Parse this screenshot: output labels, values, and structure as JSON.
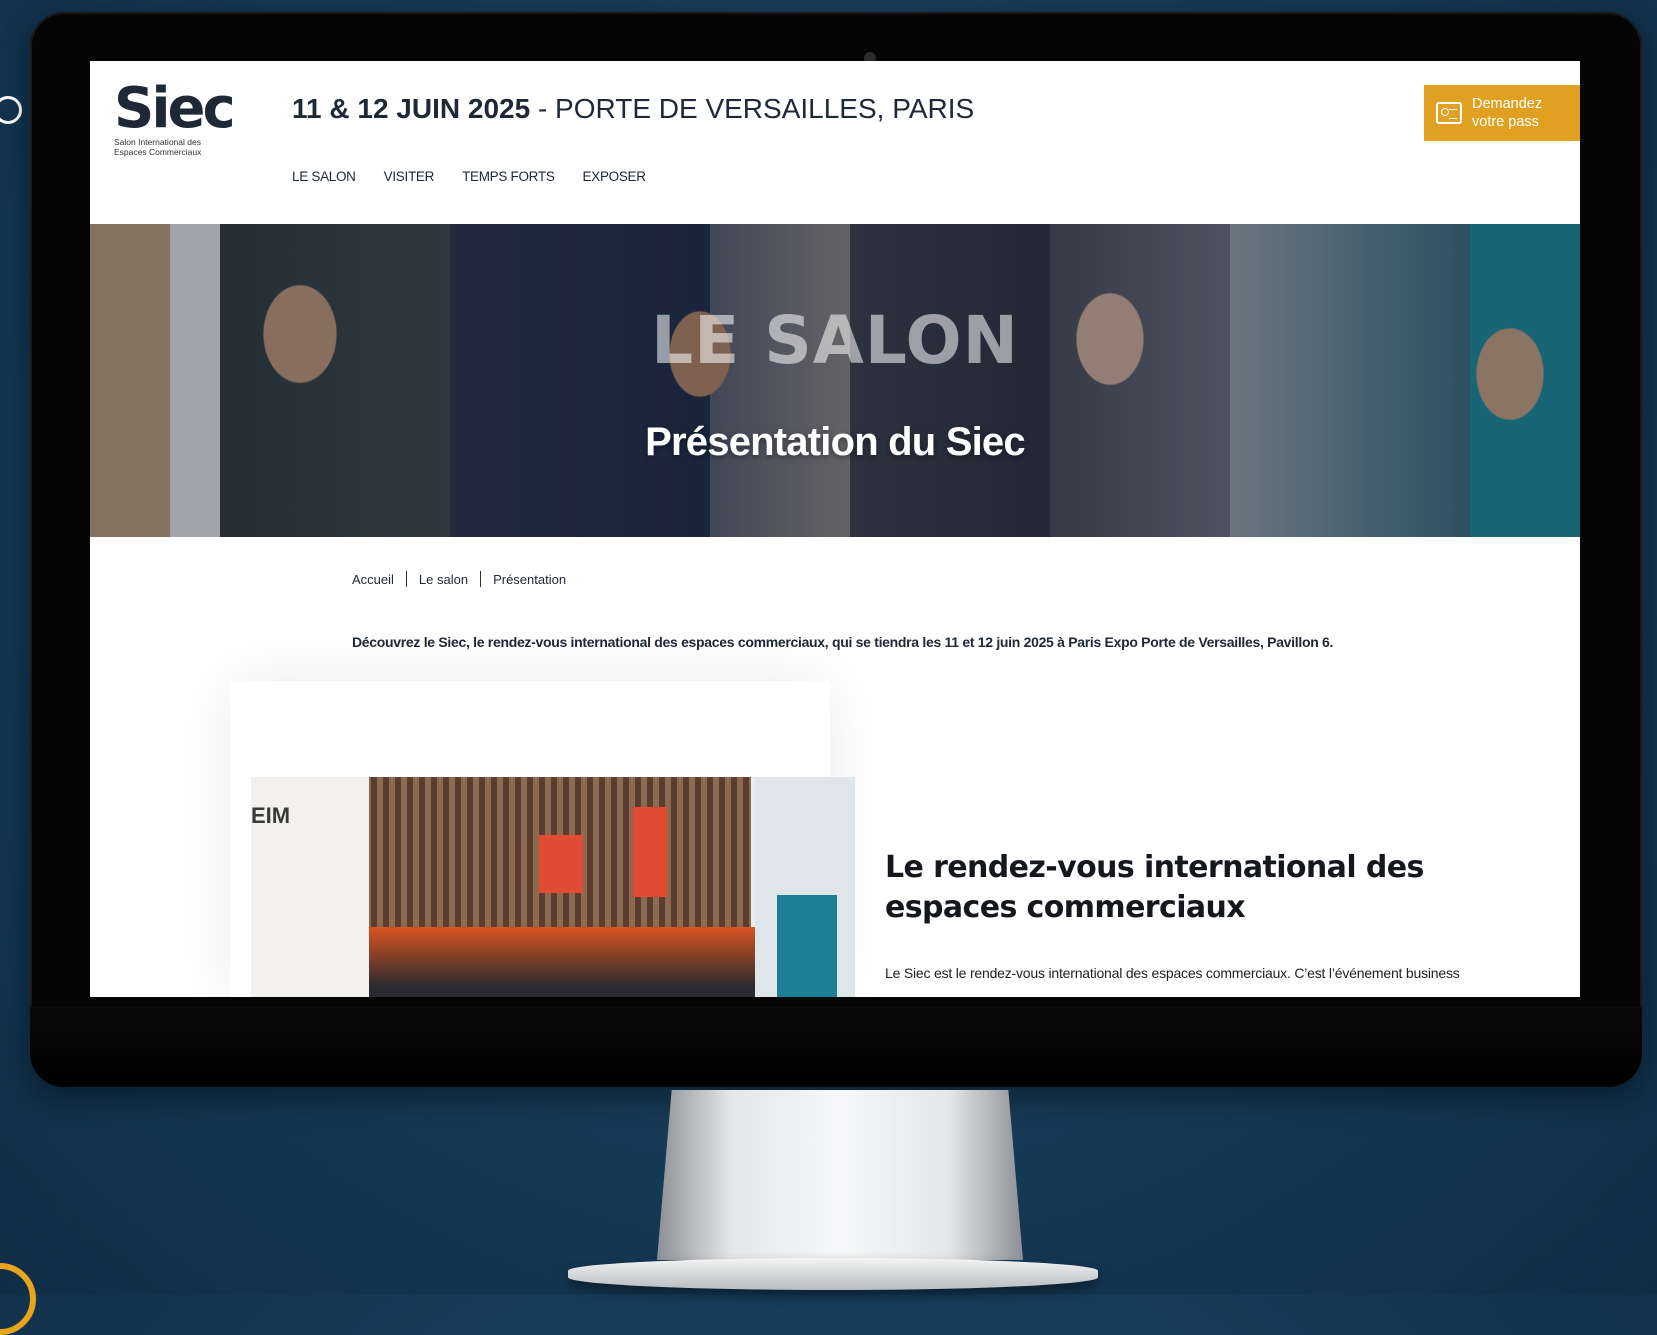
{
  "logo": {
    "mark": "Siec",
    "subtitle": "Salon International des Espaces Commerciaux"
  },
  "header": {
    "date_bold": "11 & 12 JUIN 2025",
    "location": " - PORTE DE VERSAILLES, PARIS",
    "cta_label": "Demandez votre pass"
  },
  "nav": [
    "LE SALON",
    "VISITER",
    "TEMPS FORTS",
    "EXPOSER"
  ],
  "hero": {
    "ghost_text": "LE SALON",
    "title": "Présentation du Siec"
  },
  "breadcrumb": [
    "Accueil",
    "Le salon",
    "Présentation"
  ],
  "intro": "Découvrez le Siec, le rendez-vous international des espaces commerciaux, qui se tiendra les 11 et 12 juin 2025 à Paris Expo Porte de Versailles, Pavillon 6.",
  "section": {
    "title": "Le rendez-vous international des espaces commerciaux",
    "text": "Le Siec est le rendez-vous international des espaces commerciaux. C’est l’événement business"
  },
  "photo": {
    "stand_text": "EIM"
  },
  "colors": {
    "background": "#163a57",
    "accent": "#e0a123",
    "text": "#1e2836"
  }
}
